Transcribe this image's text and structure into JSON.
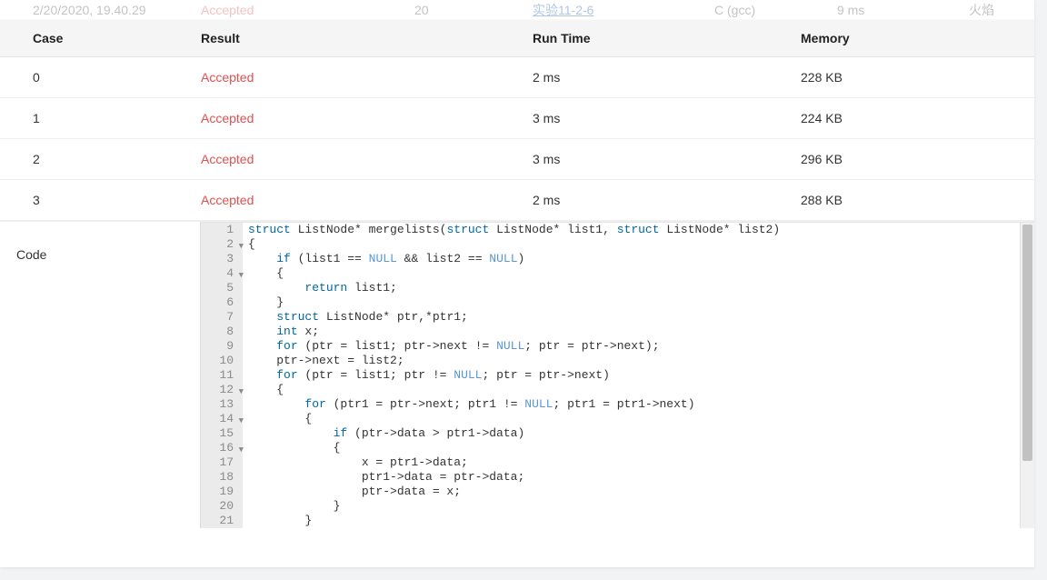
{
  "summary": {
    "date": "2/20/2020, 19.40.29",
    "status": "Accepted",
    "score": "20",
    "problem": "实验11-2-6",
    "language": "C (gcc)",
    "time": "9 ms",
    "user": "火焰"
  },
  "headers": {
    "case": "Case",
    "result": "Result",
    "runtime": "Run Time",
    "memory": "Memory"
  },
  "rows": [
    {
      "case": "0",
      "result": "Accepted",
      "runtime": "2 ms",
      "memory": "228 KB"
    },
    {
      "case": "1",
      "result": "Accepted",
      "runtime": "3 ms",
      "memory": "224 KB"
    },
    {
      "case": "2",
      "result": "Accepted",
      "runtime": "3 ms",
      "memory": "296 KB"
    },
    {
      "case": "3",
      "result": "Accepted",
      "runtime": "2 ms",
      "memory": "288 KB"
    }
  ],
  "code_label": "Code",
  "code": [
    {
      "n": 1,
      "fold": "",
      "tokens": [
        [
          "kw",
          "struct"
        ],
        [
          "",
          " ListNode* "
        ],
        [
          "id",
          "mergelists"
        ],
        [
          "",
          "("
        ],
        [
          "kw",
          "struct"
        ],
        [
          "",
          " ListNode* list1, "
        ],
        [
          "kw",
          "struct"
        ],
        [
          "",
          " ListNode* list2)"
        ]
      ]
    },
    {
      "n": 2,
      "fold": "▼",
      "tokens": [
        [
          "",
          "{"
        ]
      ]
    },
    {
      "n": 3,
      "fold": "",
      "tokens": [
        [
          "",
          "    "
        ],
        [
          "kw",
          "if"
        ],
        [
          "",
          " (list1 == "
        ],
        [
          "null",
          "NULL"
        ],
        [
          "",
          " && list2 == "
        ],
        [
          "null",
          "NULL"
        ],
        [
          "",
          ")"
        ]
      ]
    },
    {
      "n": 4,
      "fold": "▼",
      "tokens": [
        [
          "",
          "    {"
        ]
      ]
    },
    {
      "n": 5,
      "fold": "",
      "tokens": [
        [
          "",
          "        "
        ],
        [
          "kw",
          "return"
        ],
        [
          "",
          " list1;"
        ]
      ]
    },
    {
      "n": 6,
      "fold": "",
      "tokens": [
        [
          "",
          "    }"
        ]
      ]
    },
    {
      "n": 7,
      "fold": "",
      "tokens": [
        [
          "",
          "    "
        ],
        [
          "kw",
          "struct"
        ],
        [
          "",
          " ListNode* ptr,*ptr1;"
        ]
      ]
    },
    {
      "n": 8,
      "fold": "",
      "tokens": [
        [
          "",
          "    "
        ],
        [
          "kw",
          "int"
        ],
        [
          "",
          " x;"
        ]
      ]
    },
    {
      "n": 9,
      "fold": "",
      "tokens": [
        [
          "",
          "    "
        ],
        [
          "kw",
          "for"
        ],
        [
          "",
          " (ptr = list1; ptr->next != "
        ],
        [
          "null",
          "NULL"
        ],
        [
          "",
          "; ptr = ptr->next);"
        ]
      ]
    },
    {
      "n": 10,
      "fold": "",
      "tokens": [
        [
          "",
          "    ptr->next = list2;"
        ]
      ]
    },
    {
      "n": 11,
      "fold": "",
      "tokens": [
        [
          "",
          "    "
        ],
        [
          "kw",
          "for"
        ],
        [
          "",
          " (ptr = list1; ptr != "
        ],
        [
          "null",
          "NULL"
        ],
        [
          "",
          "; ptr = ptr->next)"
        ]
      ]
    },
    {
      "n": 12,
      "fold": "▼",
      "tokens": [
        [
          "",
          "    {"
        ]
      ]
    },
    {
      "n": 13,
      "fold": "",
      "tokens": [
        [
          "",
          "        "
        ],
        [
          "kw",
          "for"
        ],
        [
          "",
          " (ptr1 = ptr->next; ptr1 != "
        ],
        [
          "null",
          "NULL"
        ],
        [
          "",
          "; ptr1 = ptr1->next)"
        ]
      ]
    },
    {
      "n": 14,
      "fold": "▼",
      "tokens": [
        [
          "",
          "        {"
        ]
      ]
    },
    {
      "n": 15,
      "fold": "",
      "tokens": [
        [
          "",
          "            "
        ],
        [
          "kw",
          "if"
        ],
        [
          "",
          " (ptr->data > ptr1->data)"
        ]
      ]
    },
    {
      "n": 16,
      "fold": "▼",
      "tokens": [
        [
          "",
          "            {"
        ]
      ]
    },
    {
      "n": 17,
      "fold": "",
      "tokens": [
        [
          "",
          "                x = ptr1->data;"
        ]
      ]
    },
    {
      "n": 18,
      "fold": "",
      "tokens": [
        [
          "",
          "                ptr1->data = ptr->data;"
        ]
      ]
    },
    {
      "n": 19,
      "fold": "",
      "tokens": [
        [
          "",
          "                ptr->data = x;"
        ]
      ]
    },
    {
      "n": 20,
      "fold": "",
      "tokens": [
        [
          "",
          "            }"
        ]
      ]
    },
    {
      "n": 21,
      "fold": "",
      "tokens": [
        [
          "",
          "        }"
        ]
      ]
    }
  ]
}
